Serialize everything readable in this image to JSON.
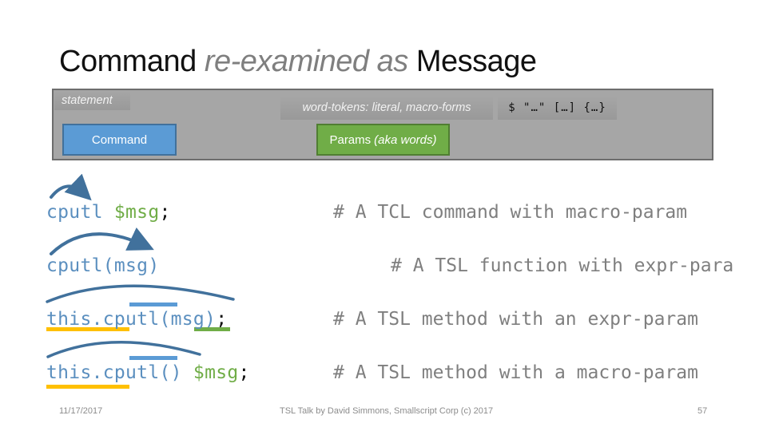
{
  "slide": {
    "title": {
      "part1": "Command",
      "part2_italic": "re-examined as",
      "part3": "Message"
    },
    "panel": {
      "statement_label": "statement",
      "word_tokens_label": "word-tokens: literal, macro-forms",
      "token_forms": "$ \"…\" […] {…}",
      "command_label": "Command",
      "params_label": "Params",
      "params_aside": "(aka words)"
    },
    "code_lines": [
      {
        "segments": [
          {
            "text": "cputl ",
            "role": "command"
          },
          {
            "text": "$msg",
            "role": "param"
          },
          {
            "text": ";",
            "role": "punct"
          }
        ],
        "comment": "# A TCL command with macro-param"
      },
      {
        "segments": [
          {
            "text": "cputl(msg)",
            "role": "command"
          }
        ],
        "comment": "# A TSL function with expr-para"
      },
      {
        "segments": [
          {
            "text": "this.cputl(msg)",
            "role": "command"
          },
          {
            "text": ";",
            "role": "punct"
          }
        ],
        "comment": "# A TSL method with an expr-param"
      },
      {
        "segments": [
          {
            "text": "this.cputl() ",
            "role": "command"
          },
          {
            "text": "$msg",
            "role": "param"
          },
          {
            "text": ";",
            "role": "punct"
          }
        ],
        "comment": "# A TSL method with a macro-param"
      }
    ],
    "colors": {
      "command": "#5b9bd5",
      "param": "#70ad47",
      "receiver_underline": "#ffc000",
      "arrow": "#41719c",
      "panel": "#a6a6a6"
    },
    "footer": {
      "date": "11/17/2017",
      "center": "TSL Talk by David Simmons, Smallscript Corp (c) 2017",
      "page_number": "57"
    }
  }
}
